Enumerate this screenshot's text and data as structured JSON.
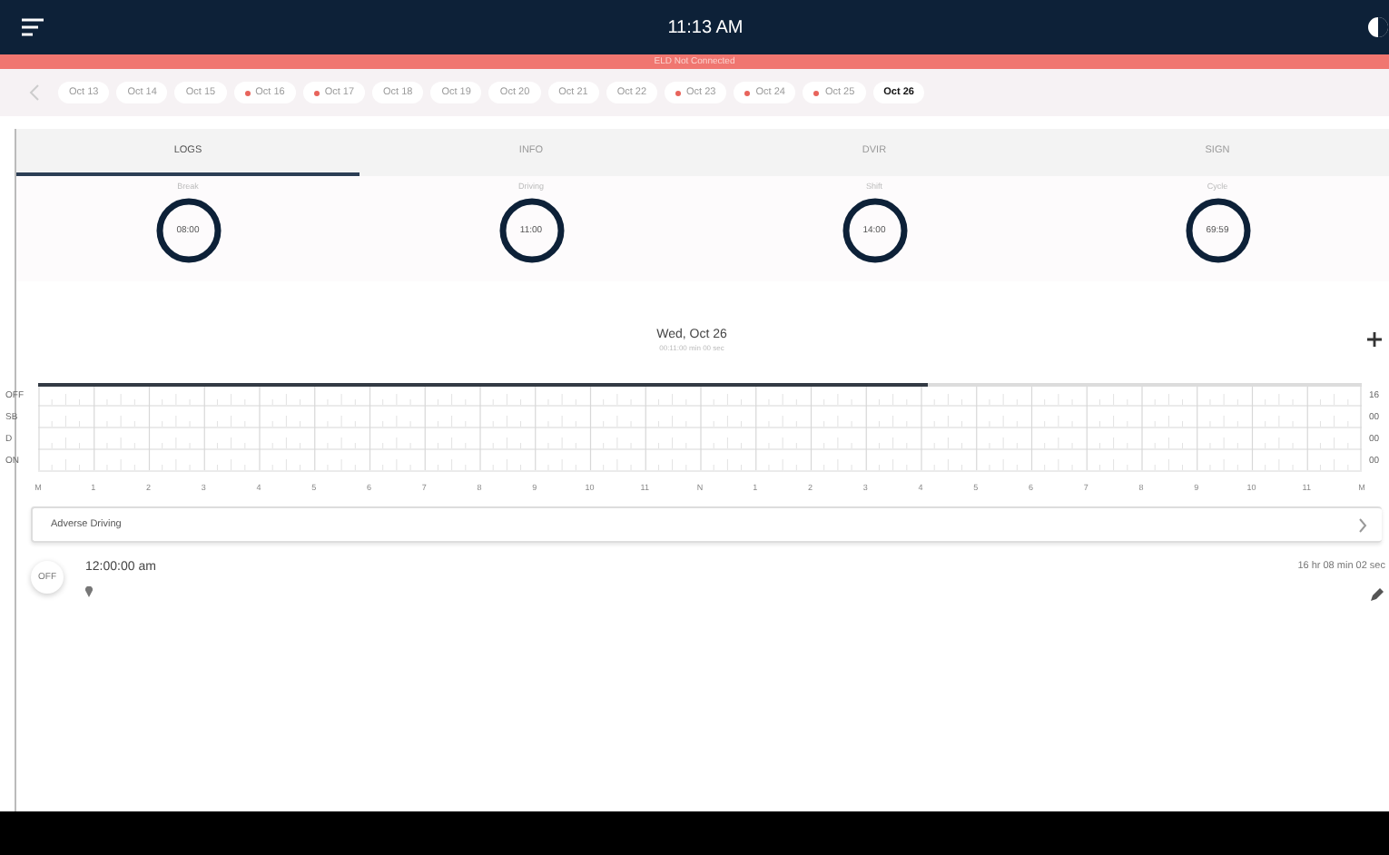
{
  "header": {
    "time": "11:13 AM"
  },
  "banner": {
    "text": "ELD Not Connected"
  },
  "dates": [
    {
      "label": "Oct 13",
      "flagged": false,
      "selected": false
    },
    {
      "label": "Oct 14",
      "flagged": false,
      "selected": false
    },
    {
      "label": "Oct 15",
      "flagged": false,
      "selected": false
    },
    {
      "label": "Oct 16",
      "flagged": true,
      "selected": false
    },
    {
      "label": "Oct 17",
      "flagged": true,
      "selected": false
    },
    {
      "label": "Oct 18",
      "flagged": false,
      "selected": false
    },
    {
      "label": "Oct 19",
      "flagged": false,
      "selected": false
    },
    {
      "label": "Oct 20",
      "flagged": false,
      "selected": false
    },
    {
      "label": "Oct 21",
      "flagged": false,
      "selected": false
    },
    {
      "label": "Oct 22",
      "flagged": false,
      "selected": false
    },
    {
      "label": "Oct 23",
      "flagged": true,
      "selected": false
    },
    {
      "label": "Oct 24",
      "flagged": true,
      "selected": false
    },
    {
      "label": "Oct 25",
      "flagged": true,
      "selected": false
    },
    {
      "label": "Oct 26",
      "flagged": false,
      "selected": true
    }
  ],
  "tabs": [
    {
      "label": "LOGS",
      "selected": true
    },
    {
      "label": "INFO",
      "selected": false
    },
    {
      "label": "DVIR",
      "selected": false
    },
    {
      "label": "SIGN",
      "selected": false
    }
  ],
  "clocks": [
    {
      "label": "Break",
      "value": "08:00"
    },
    {
      "label": "Driving",
      "value": "11:00"
    },
    {
      "label": "Shift",
      "value": "14:00"
    },
    {
      "label": "Cycle",
      "value": "69:59"
    }
  ],
  "day": {
    "title": "Wed, Oct 26",
    "subtitle": "00:11:00 min 00 sec"
  },
  "log_graph": {
    "statuses": [
      "OFF",
      "SB",
      "D",
      "ON"
    ],
    "totals": [
      "16",
      "00",
      "00",
      "00"
    ],
    "hours": [
      "M",
      "1",
      "2",
      "3",
      "4",
      "5",
      "6",
      "7",
      "8",
      "9",
      "10",
      "11",
      "N",
      "1",
      "2",
      "3",
      "4",
      "5",
      "6",
      "7",
      "8",
      "9",
      "10",
      "11",
      "M"
    ],
    "off_duty_line": {
      "level": 0.672
    }
  },
  "adverse": {
    "label": "Adverse Driving"
  },
  "events": [
    {
      "status": "OFF",
      "time": "12:00:00 am",
      "duration": "16 hr 08 min 02 sec"
    }
  ]
}
